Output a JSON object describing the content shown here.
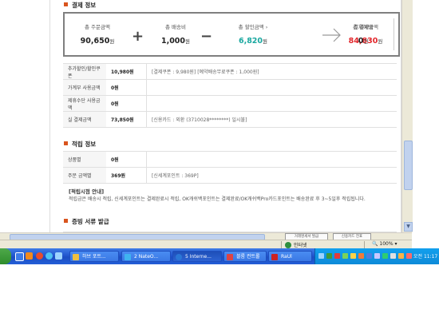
{
  "payment": {
    "section_title": "결제 정보",
    "columns": [
      {
        "label": "총 주문금액",
        "value": "90,650",
        "unit": "원"
      },
      {
        "label": "총 배송비",
        "value": "1,000",
        "unit": "원"
      },
      {
        "label": "총 할인금액 ›",
        "value": "6,820",
        "unit": "원"
      },
      {
        "label": "총 결제금액",
        "value": "84,830",
        "unit": "원"
      },
      {
        "label": "결제혜택",
        "value": "0",
        "unit": "건"
      }
    ],
    "op_plus": "+",
    "op_minus": "−",
    "colors": {
      "discount": "#1aa8a0",
      "total": "#e2262b"
    }
  },
  "details": [
    {
      "label": "추가할인/할인쿠폰",
      "value": "10,980원",
      "desc": "[결제쿠폰 : 9,980원] [예약배송무료쿠폰 : 1,000원]"
    },
    {
      "label": "가계부 사용금액",
      "value": "0원",
      "desc": ""
    },
    {
      "label": "제휴수단 사용금액",
      "value": "0원",
      "desc": ""
    },
    {
      "label": "실 결제금액",
      "value": "73,850원",
      "desc": "[신용카드 : 외환 (3710028********) 일시불]"
    }
  ],
  "points": {
    "section_title": "적립 정보",
    "rows": [
      {
        "label": "상품별",
        "value": "0원",
        "desc": ""
      },
      {
        "label": "주문 금액별",
        "value": "369원",
        "desc": "[신세계포인트 : 369P]"
      }
    ],
    "notice_title": "[적립시점 안내]",
    "notice_text": "적립금은 배송시 적립, 신세계포인트는 결제완료시 적립, OK캐쉬백포인트는 결제완료/OK캐쉬백Pro카드포인트는 배송완료 후 3~5일후 적립됩니다."
  },
  "docs": {
    "section_title": "증빙 서류 발급"
  },
  "page_buttons": [
    "거래명세서 발급",
    "신용카드 전표"
  ],
  "statusbar": {
    "zone": "인터넷",
    "zoom": "100%"
  },
  "taskbar": {
    "tasks": [
      {
        "label": "하브 포트...",
        "icon_color": "#f0c040"
      },
      {
        "label": "2 NateO...",
        "icon_color": "#3fb3f0"
      },
      {
        "label": "5 Interne...",
        "icon_color": "#2b77d6"
      },
      {
        "label": "블룸 컨트롤",
        "icon_color": "#d44"
      },
      {
        "label": "RaUl",
        "icon_color": "#c22"
      }
    ],
    "clock": "오전 11:17"
  }
}
